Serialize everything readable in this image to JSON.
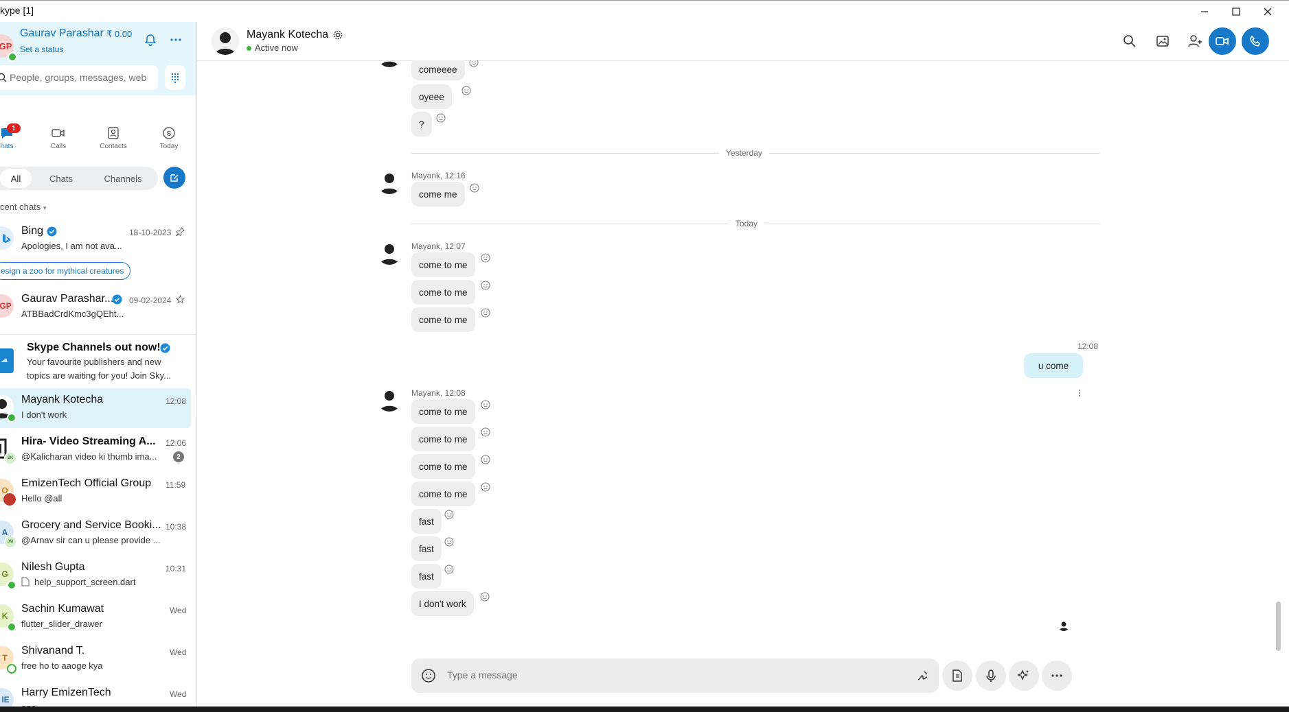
{
  "window": {
    "title": "kype [1]"
  },
  "profile": {
    "initials": "GP",
    "name": "Gaurav Parashar",
    "credit": "₹ 0.00",
    "status_link": "Set a status"
  },
  "search": {
    "placeholder": "People, groups, messages, web"
  },
  "nav": [
    {
      "label": "hats",
      "badge": "1"
    },
    {
      "label": "Calls"
    },
    {
      "label": "Contacts"
    },
    {
      "label": "Today"
    }
  ],
  "filters": {
    "all": "All",
    "chats": "Chats",
    "channels": "Channels"
  },
  "recent_label": "cent chats",
  "suggestion": "esign a zoo for mythical creatures",
  "chats": [
    {
      "name": "Bing",
      "preview": "Apologies, I am not ava...",
      "time": "18-10-2023",
      "verified": true,
      "pinned": true
    },
    {
      "name": "Gaurav Parashar...",
      "preview": "ATBBadCrdKmc3gQEht...",
      "time": "09-02-2024",
      "verified": true,
      "initials": "GP"
    },
    {
      "name": "Skype Channels out now!",
      "preview1": "Your favourite publishers and new",
      "preview2": "topics are waiting for you! Join Sky...",
      "verified": true
    },
    {
      "name": "Mayank Kotecha",
      "preview": "I don't work",
      "time": "12:08"
    },
    {
      "name": "Hira- Video Streaming A...",
      "preview": "@Kalicharan video ki thumb ima...",
      "time": "12:06",
      "unread": "2",
      "small_initials": "SK"
    },
    {
      "name": "EmizenTech Official Group",
      "preview": "Hello @all",
      "time": "11:59",
      "initials": "O"
    },
    {
      "name": "Grocery and Service Booki...",
      "preview": "@Arnav sir can u please provide ...",
      "time": "10:38",
      "initials": "A",
      "small_initials": "JM"
    },
    {
      "name": "Nilesh Gupta",
      "preview": "help_support_screen.dart",
      "time": "10:31",
      "initials": "G"
    },
    {
      "name": "Sachin Kumawat",
      "preview": "flutter_slider_drawer",
      "time": "Wed",
      "initials": "K"
    },
    {
      "name": "Shivanand T.",
      "preview": "free ho to aaoge kya",
      "time": "Wed",
      "initials": "T"
    },
    {
      "name": "Harry EmizenTech",
      "preview": "ana",
      "time": "Wed",
      "initials": "IE"
    }
  ],
  "conversation": {
    "contact": "Mayank Kotecha",
    "presence": "Active now",
    "top_messages": [
      "comeeee",
      "oyeee",
      "?"
    ],
    "yesterday_label": "Yesterday",
    "yesterday_meta": "Mayank, 12:16",
    "yesterday_messages": [
      "come me"
    ],
    "today_label": "Today",
    "today_meta1": "Mayank, 12:07",
    "today_group1": [
      "come to me",
      "come to me",
      "come to me"
    ],
    "my_time": "12:08",
    "my_message": "u come",
    "today_meta2": "Mayank, 12:08",
    "today_group2": [
      "come to me",
      "come to me",
      "come to me",
      "come to me",
      "fast",
      "fast",
      "fast",
      "I don't work"
    ]
  },
  "composer": {
    "placeholder": "Type a message"
  },
  "colors": {
    "accent": "#1678c6",
    "sidebar_top": "#e4f5fb",
    "my_bubble": "#d7f1fb",
    "bubble": "#ededed"
  }
}
